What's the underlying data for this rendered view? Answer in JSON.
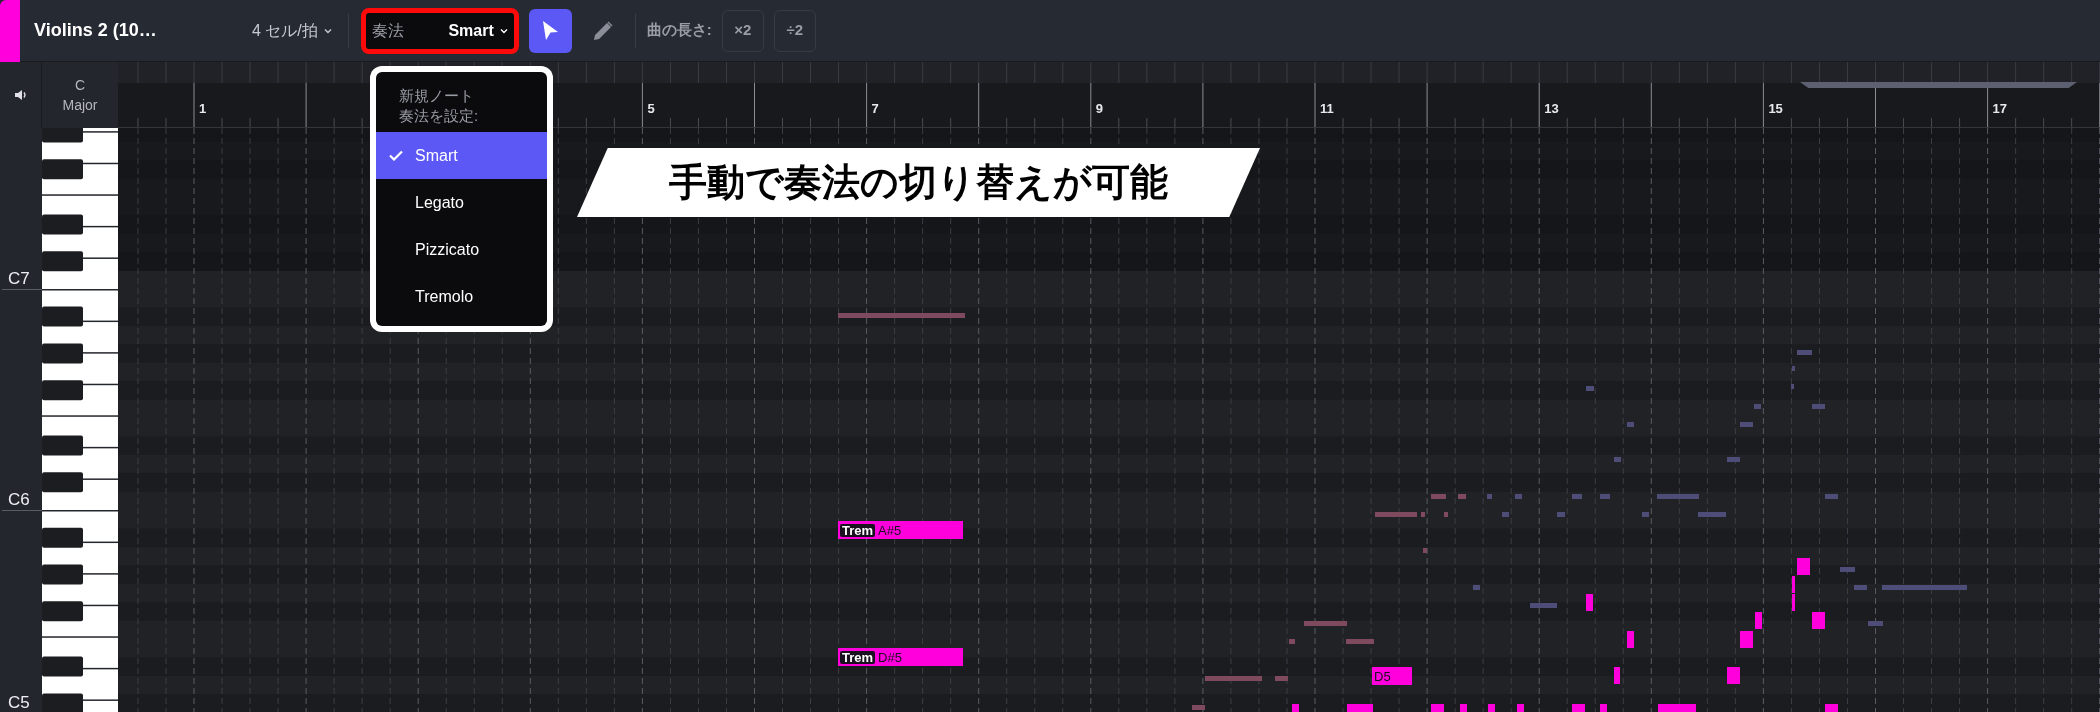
{
  "track": {
    "name": "Violins 2 (10…",
    "color": "#ff00dd"
  },
  "grid": {
    "label": "4 セル/拍"
  },
  "articulation": {
    "label": "奏法",
    "value": "Smart"
  },
  "tools": [
    {
      "kind": "select",
      "selected": true
    },
    {
      "kind": "pencil",
      "selected": false
    }
  ],
  "length": {
    "label": "曲の長さ:",
    "buttons": [
      "×2",
      "÷2"
    ]
  },
  "key": {
    "tonic": "C",
    "mode": "Major"
  },
  "ruler": {
    "bar_numbers": [
      "1",
      "5",
      "7",
      "9",
      "11",
      "13",
      "15",
      "17"
    ]
  },
  "menu": {
    "heading_lines": [
      "新規ノート",
      "奏法を設定:"
    ],
    "items": [
      {
        "label": "Smart",
        "selected": true
      },
      {
        "label": "Legato",
        "selected": false
      },
      {
        "label": "Pizzicato",
        "selected": false
      },
      {
        "label": "Tremolo",
        "selected": false
      }
    ]
  },
  "callout": {
    "text": "手動で奏法の切り替えが可能"
  },
  "piano": {
    "octave_labels": [
      "C7",
      "C6",
      "C5"
    ]
  },
  "notes": [
    {
      "articulation": "Trem",
      "pitch": "A#5"
    },
    {
      "articulation": "Trem",
      "pitch": "D#5"
    },
    {
      "pitch": "D5"
    }
  ]
}
